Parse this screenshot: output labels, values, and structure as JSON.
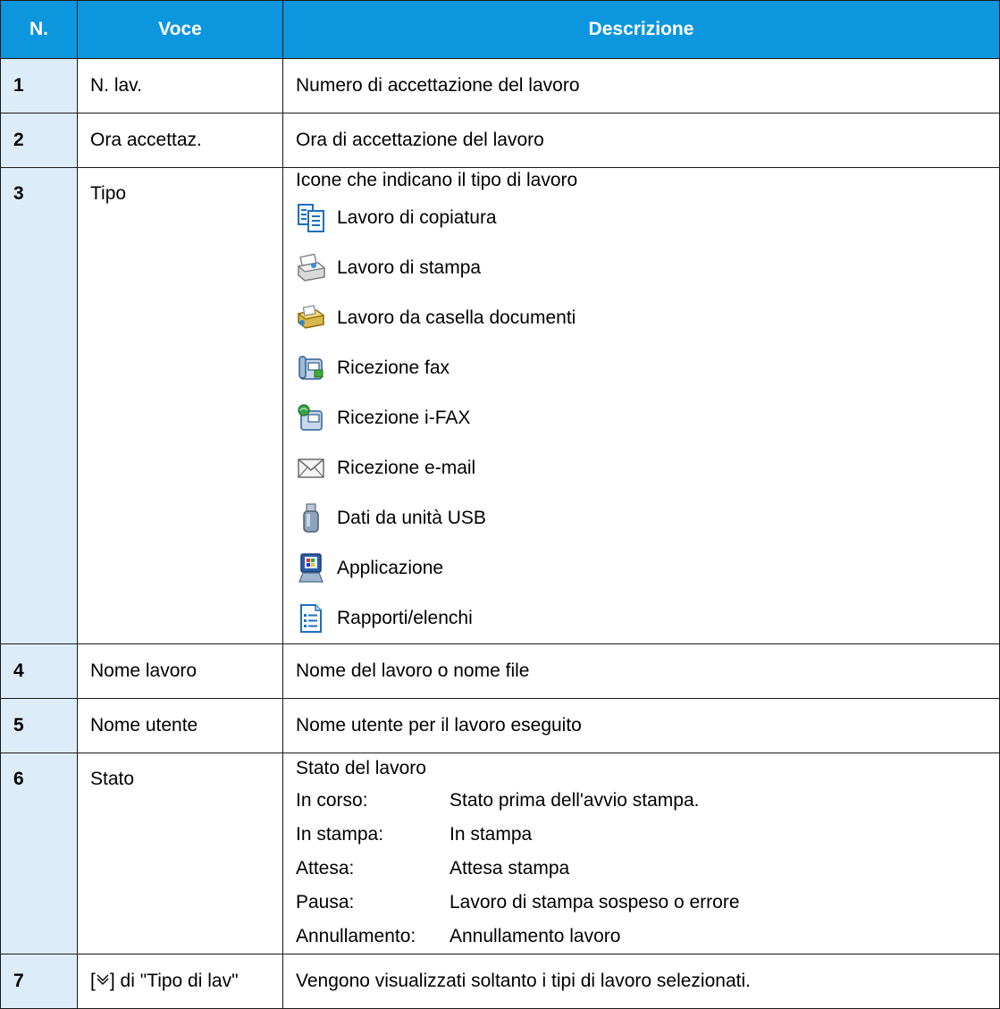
{
  "header": {
    "col_n": "N.",
    "col_voce": "Voce",
    "col_desc": "Descrizione"
  },
  "rows": [
    {
      "n": "1",
      "voce": "N. lav.",
      "desc": "Numero di accettazione del lavoro"
    },
    {
      "n": "2",
      "voce": "Ora accettaz.",
      "desc": "Ora di accettazione del lavoro"
    },
    {
      "n": "3",
      "voce": "Tipo",
      "desc": "Icone che indicano il tipo di lavoro",
      "types": [
        {
          "icon": "copy-job-icon",
          "label": "Lavoro di copiatura"
        },
        {
          "icon": "print-job-icon",
          "label": "Lavoro di stampa"
        },
        {
          "icon": "document-box-job-icon",
          "label": "Lavoro da casella documenti"
        },
        {
          "icon": "fax-receive-icon",
          "label": "Ricezione fax"
        },
        {
          "icon": "ifax-receive-icon",
          "label": "Ricezione i-FAX"
        },
        {
          "icon": "email-receive-icon",
          "label": "Ricezione e-mail"
        },
        {
          "icon": "usb-data-icon",
          "label": "Dati da unità USB"
        },
        {
          "icon": "application-icon",
          "label": "Applicazione"
        },
        {
          "icon": "report-list-icon",
          "label": "Rapporti/elenchi"
        }
      ]
    },
    {
      "n": "4",
      "voce": "Nome lavoro",
      "desc": "Nome del lavoro o nome file"
    },
    {
      "n": "5",
      "voce": "Nome utente",
      "desc": "Nome utente per il lavoro eseguito"
    },
    {
      "n": "6",
      "voce": "Stato",
      "desc": "Stato del lavoro",
      "statuses": [
        {
          "key": "In corso:",
          "value": "Stato prima dell'avvio stampa."
        },
        {
          "key": "In stampa:",
          "value": "In stampa"
        },
        {
          "key": "Attesa:",
          "value": "Attesa stampa"
        },
        {
          "key": "Pausa:",
          "value": "Lavoro di stampa sospeso o errore"
        },
        {
          "key": "Annullamento:",
          "value": "Annullamento lavoro"
        }
      ]
    },
    {
      "n": "7",
      "voce_pre": "[",
      "voce_icon": "chevron-down-icon",
      "voce_post": "] di \"Tipo di lav\"",
      "desc": "Vengono visualizzati soltanto i tipi di lavoro selezionati."
    }
  ],
  "colors": {
    "header_bg": "#0b96de",
    "num_col_bg": "#dcedf9",
    "border": "#1a1a1a"
  }
}
